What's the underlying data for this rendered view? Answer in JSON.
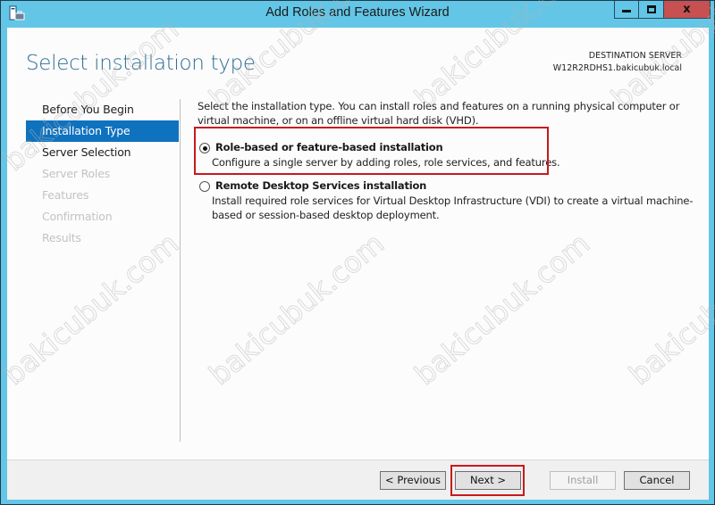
{
  "window": {
    "title": "Add Roles and Features Wizard",
    "app_icon": "server-manager-icon",
    "controls": {
      "minimize": "minimize-icon",
      "maximize": "maximize-icon",
      "close_glyph": "x"
    }
  },
  "header": {
    "page_title": "Select installation type",
    "destination_label": "DESTINATION SERVER",
    "destination_server": "W12R2RDHS1.bakicubuk.local"
  },
  "nav": {
    "items": [
      {
        "label": "Before You Begin",
        "state": "normal"
      },
      {
        "label": "Installation Type",
        "state": "active"
      },
      {
        "label": "Server Selection",
        "state": "normal"
      },
      {
        "label": "Server Roles",
        "state": "disabled"
      },
      {
        "label": "Features",
        "state": "disabled"
      },
      {
        "label": "Confirmation",
        "state": "disabled"
      },
      {
        "label": "Results",
        "state": "disabled"
      }
    ]
  },
  "content": {
    "intro": "Select the installation type. You can install roles and features on a running physical computer or virtual machine, or on an offline virtual hard disk (VHD).",
    "options": [
      {
        "label": "Role-based or feature-based installation",
        "description": "Configure a single server by adding roles, role services, and features.",
        "selected": true
      },
      {
        "label": "Remote Desktop Services installation",
        "description": "Install required role services for Virtual Desktop Infrastructure (VDI) to create a virtual machine-based or session-based desktop deployment.",
        "selected": false
      }
    ]
  },
  "footer": {
    "previous": "< Previous",
    "next": "Next >",
    "install": "Install",
    "cancel": "Cancel"
  },
  "watermark": "bakicubuk.com",
  "colors": {
    "titlebar": "#63c6e7",
    "close_button": "#c75050",
    "nav_active": "#0f72bf",
    "page_title": "#2f6e95",
    "highlight": "#c8191f"
  }
}
